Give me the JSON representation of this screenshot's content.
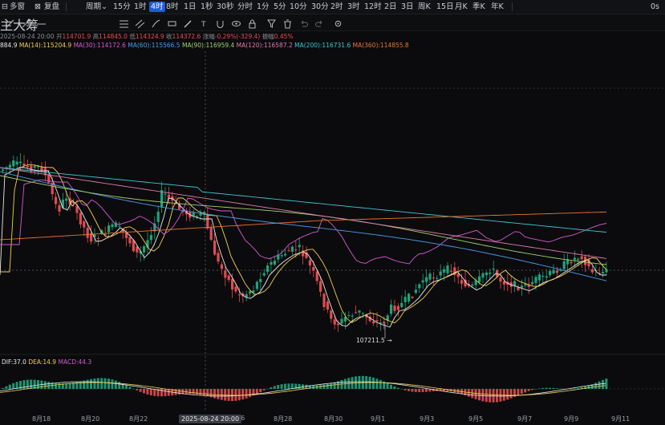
{
  "toolbar": {
    "multi_window": "多窗",
    "replay": "复盘",
    "period": "周期",
    "intervals": [
      "15分",
      "1时",
      "4时",
      "8时",
      "1日",
      "1秒",
      "30秒",
      "分时",
      "1分",
      "5分",
      "10分",
      "30分",
      "2时",
      "3时",
      "12时",
      "2日",
      "3日",
      "周K",
      "15日",
      "月K",
      "季K",
      "年K"
    ],
    "active_interval": "4时",
    "indicators": [
      "主",
      "大",
      "筹"
    ],
    "right_label": "0s"
  },
  "ohlc": {
    "date": "2025-08-24 20:00",
    "open_label": "开",
    "open": "114701.9",
    "high_label": "高",
    "high": "114845.0",
    "low_label": "低",
    "low": "114324.9",
    "close_label": "收",
    "close": "114372.6",
    "change_label": "涨幅",
    "change": "-0.29%(-329.4)",
    "amplitude_label": "振幅",
    "amplitude": "0.45%"
  },
  "ma_line": [
    {
      "text": "884.9",
      "color": "#e8e8e8"
    },
    {
      "text": "MA(14):115204.9",
      "color": "#f0d050"
    },
    {
      "text": "MA(30):114172.6",
      "color": "#d45ad0"
    },
    {
      "text": "MA(60):115566.5",
      "color": "#4a9be8"
    },
    {
      "text": "MA(90):116959.4",
      "color": "#a2cf6e"
    },
    {
      "text": "MA(120):116587.2",
      "color": "#e07aa8"
    },
    {
      "text": "MA(200):116731.6",
      "color": "#3fc6d6"
    },
    {
      "text": "MA(360):114855.8",
      "color": "#e8762e"
    }
  ],
  "chart": {
    "low_marker": "107211.5",
    "crosshair_time": "2025-08-24 20:00"
  },
  "macd": {
    "dif": "DIF:37.0",
    "dea": "DEA:14.9",
    "macd": "MACD:44.3"
  },
  "xaxis": {
    "labels": [
      "8月18",
      "8月20",
      "8月22",
      "26",
      "8月28",
      "8月30",
      "9月1",
      "9月3",
      "9月5",
      "9月7",
      "9月9",
      "9月11"
    ]
  },
  "colors": {
    "up": "#1fa37a",
    "down": "#e24b4f",
    "accent": "#1e5bd8"
  }
}
